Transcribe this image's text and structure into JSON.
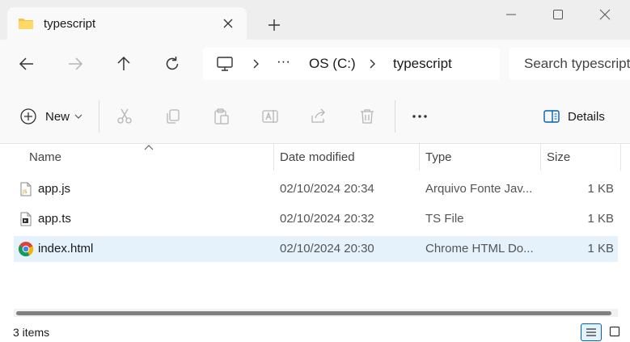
{
  "tab": {
    "title": "typescript",
    "icon": "folder-icon"
  },
  "window_controls": [
    "minimize",
    "maximize",
    "close"
  ],
  "address": {
    "ellipsis": "···",
    "drive": "OS (C:)",
    "folder": "typescript"
  },
  "search": {
    "placeholder": "Search typescript"
  },
  "command_bar": {
    "new_label": "New",
    "details_label": "Details"
  },
  "columns": {
    "name": "Name",
    "date": "Date modified",
    "type": "Type",
    "size": "Size"
  },
  "files": [
    {
      "name": "app.js",
      "date": "02/10/2024 20:34",
      "type": "Arquivo Fonte Jav...",
      "size": "1 KB",
      "icon": "js-file-icon"
    },
    {
      "name": "app.ts",
      "date": "02/10/2024 20:32",
      "type": "TS File",
      "size": "1 KB",
      "icon": "ts-file-icon"
    },
    {
      "name": "index.html",
      "date": "02/10/2024 20:30",
      "type": "Chrome HTML Do...",
      "size": "1 KB",
      "icon": "chrome-icon"
    }
  ],
  "selected_index": 2,
  "status": {
    "items_text": "3 items"
  },
  "colors": {
    "selection": "#e5f1fb",
    "accent": "#005fb8",
    "folder": "#f6c342"
  }
}
